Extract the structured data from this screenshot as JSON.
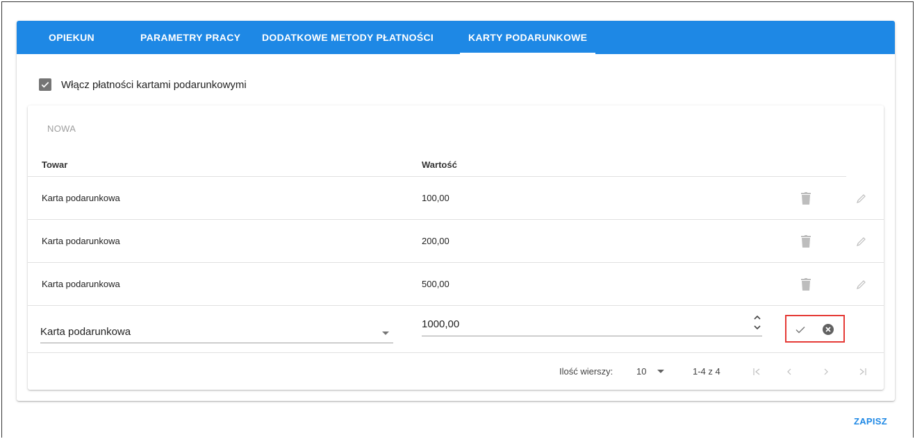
{
  "tabs": [
    {
      "label": "OPIEKUN",
      "active": false
    },
    {
      "label": "PARAMETRY PRACY",
      "active": false
    },
    {
      "label": "DODATKOWE METODY PŁATNOŚCI",
      "active": false
    },
    {
      "label": "KARTY PODARUNKOWE",
      "active": true
    }
  ],
  "toggle": {
    "label": "Włącz płatności kartami podarunkowymi",
    "checked": true
  },
  "table": {
    "new_button": "NOWA",
    "columns": [
      "Towar",
      "Wartość"
    ],
    "rows": [
      {
        "product": "Karta podarunkowa",
        "value": "100,00"
      },
      {
        "product": "Karta podarunkowa",
        "value": "200,00"
      },
      {
        "product": "Karta podarunkowa",
        "value": "500,00"
      }
    ],
    "edit_row": {
      "product": "Karta podarunkowa",
      "value": "1000,00"
    },
    "footer": {
      "rows_per_page_label": "Ilość wierszy:",
      "rows_per_page": "10",
      "range": "1-4 z 4"
    }
  },
  "save_button": "ZAPISZ",
  "colors": {
    "accent": "#1e88e5",
    "highlight_border": "#e53935",
    "disabled_icon": "#bdbdbd"
  }
}
